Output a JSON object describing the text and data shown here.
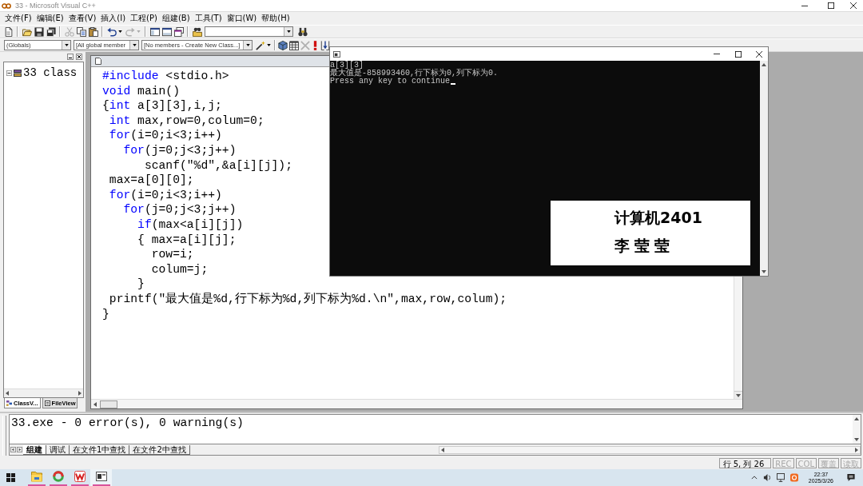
{
  "window": {
    "title": "33 - Microsoft Visual C++"
  },
  "menu": [
    "文件(F)",
    "编辑(E)",
    "查看(V)",
    "插入(I)",
    "工程(P)",
    "组建(B)",
    "工具(T)",
    "窗口(W)",
    "帮助(H)"
  ],
  "class_bar": {
    "class_combo": "(Globals)",
    "filter_combo": "[All global member",
    "member_combo": "[No members - Create New Class...]"
  },
  "workspace": {
    "tree": [
      {
        "label": "33 class",
        "expanded": true
      }
    ],
    "tabs": [
      {
        "label": "ClassV...",
        "selected": true
      },
      {
        "label": "FileView",
        "selected": false
      }
    ]
  },
  "editor": {
    "lines": [
      [
        {
          "text": "#include",
          "kind": "keyword"
        },
        {
          "text": " <stdio.h>",
          "kind": "plain"
        }
      ],
      [
        {
          "text": "void",
          "kind": "keyword"
        },
        {
          "text": " main()",
          "kind": "plain"
        }
      ],
      [
        {
          "text": "{",
          "kind": "plain"
        },
        {
          "text": "int",
          "kind": "keyword"
        },
        {
          "text": " a[3][3],i,j;",
          "kind": "plain"
        }
      ],
      [
        {
          "text": " int",
          "kind": "keyword"
        },
        {
          "text": " max,row=0,colum=0;",
          "kind": "plain"
        }
      ],
      [
        {
          "text": " for",
          "kind": "keyword"
        },
        {
          "text": "(i=0;i<3;i++)",
          "kind": "plain"
        }
      ],
      [
        {
          "text": "   for",
          "kind": "keyword"
        },
        {
          "text": "(j=0;j<3;j++)",
          "kind": "plain"
        }
      ],
      [
        {
          "text": "      scanf(\"%d\",&a[i][j]);",
          "kind": "plain"
        }
      ],
      [
        {
          "text": " max=a[0][0];",
          "kind": "plain"
        }
      ],
      [
        {
          "text": " for",
          "kind": "keyword"
        },
        {
          "text": "(i=0;i<3;i++)",
          "kind": "plain"
        }
      ],
      [
        {
          "text": "   for",
          "kind": "keyword"
        },
        {
          "text": "(j=0;j<3;j++)",
          "kind": "plain"
        }
      ],
      [
        {
          "text": "     if",
          "kind": "keyword"
        },
        {
          "text": "(max<a[i][j])",
          "kind": "plain"
        }
      ],
      [
        {
          "text": "     { max=a[i][j];",
          "kind": "plain"
        }
      ],
      [
        {
          "text": "       row=i;",
          "kind": "plain"
        }
      ],
      [
        {
          "text": "       colum=j;",
          "kind": "plain"
        }
      ],
      [
        {
          "text": "     }",
          "kind": "plain"
        }
      ],
      [
        {
          "text": " printf(\"最大值是%d,行下标为%d,列下标为%d.\\n\",max,row,colum);",
          "kind": "plain"
        }
      ],
      [
        {
          "text": "}",
          "kind": "plain"
        }
      ]
    ]
  },
  "console": {
    "lines": [
      "a[3][3]",
      "最大值是-858993460,行下标为0,列下标为0.",
      "Press any key to continue"
    ]
  },
  "name_card": {
    "lines": [
      "计算机2401",
      "李莹莹"
    ]
  },
  "output": {
    "lines": [
      "33.exe - 0 error(s), 0 warning(s)"
    ],
    "tabs": [
      {
        "label": "组建",
        "selected": true
      },
      {
        "label": "调试",
        "selected": false
      },
      {
        "label": "在文件1中查找",
        "selected": false
      },
      {
        "label": "在文件2中查找",
        "selected": false
      }
    ]
  },
  "status_bar": {
    "position": "行 5, 列 26",
    "indicators": [
      {
        "label": "REC",
        "on": false
      },
      {
        "label": "COL",
        "on": false
      },
      {
        "label": "覆盖",
        "on": false
      },
      {
        "label": "读取",
        "on": false
      }
    ]
  },
  "taskbar": {
    "apps": [
      {
        "kind": "folder",
        "running": true,
        "selected": false
      },
      {
        "kind": "ring",
        "running": true,
        "selected": false
      },
      {
        "kind": "office",
        "running": true,
        "selected": false
      },
      {
        "kind": "console",
        "running": true,
        "selected": true
      }
    ],
    "time": "22:37",
    "date": "2025/3/26"
  }
}
